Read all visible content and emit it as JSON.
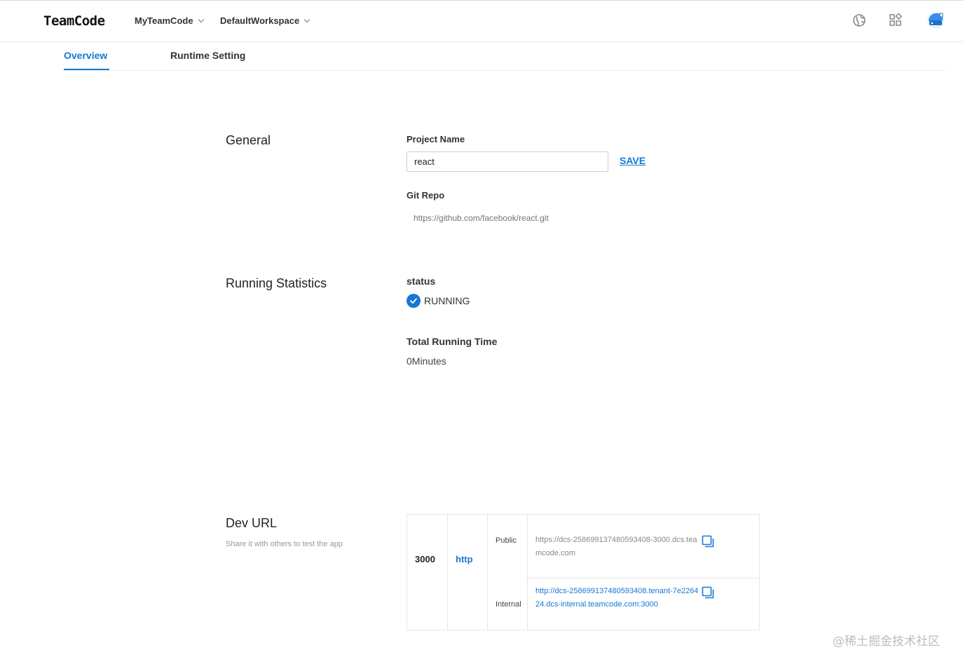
{
  "header": {
    "logo": "TeamCode",
    "team_dropdown": "MyTeamCode",
    "workspace_dropdown": "DefaultWorkspace",
    "icons": [
      "globe-icon",
      "apps-icon",
      "user-avatar-icon"
    ]
  },
  "tabs": [
    {
      "label": "Overview",
      "active": true
    },
    {
      "label": "Runtime Setting",
      "active": false
    }
  ],
  "general": {
    "title": "General",
    "project_name_label": "Project Name",
    "project_name_value": "react",
    "save_label": "SAVE",
    "git_repo_label": "Git Repo",
    "git_repo_placeholder": "https://github.com/facebook/react.git"
  },
  "running": {
    "title": "Running Statistics",
    "status_label": "status",
    "status_value": "RUNNING",
    "total_time_label": "Total Running Time",
    "total_time_value": "0Minutes"
  },
  "dev_url": {
    "title": "Dev URL",
    "subtitle": "Share it with others to test the app",
    "port": "3000",
    "protocol": "http",
    "public_label": "Public",
    "public_url": "https://dcs-258699137480593408-3000.dcs.teamcode.com",
    "internal_label": "Internal",
    "internal_url": "http://dcs-258699137480593408.tenant-7e226424.dcs-internal.teamcode.com:3000"
  },
  "watermark": "@稀土掘金技术社区",
  "colors": {
    "accent": "#1677d6",
    "text": "#333333",
    "border": "#e6e6e6"
  }
}
